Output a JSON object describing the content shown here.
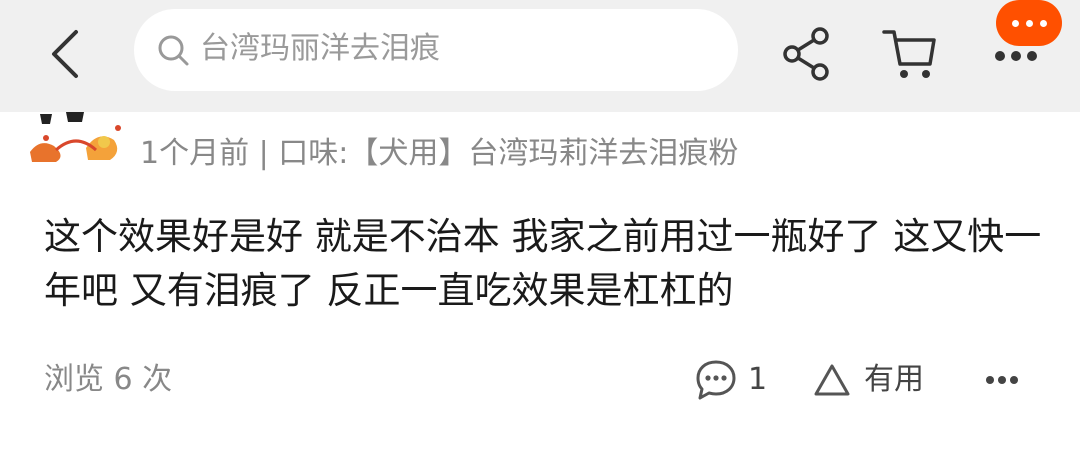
{
  "header": {
    "search_query": "台湾玛丽洋去泪痕"
  },
  "review": {
    "meta": "1个月前 | 口味:【犬用】台湾玛莉洋去泪痕粉",
    "text": "这个效果好是好 就是不治本 我家之前用过一瓶好了 这又快一年吧 又有泪痕了 反正一直吃效果是杠杠的",
    "views": "浏览 6 次",
    "comment_count": "1",
    "useful_label": "有用"
  },
  "colors": {
    "accent": "#ff5000",
    "header_bg": "#f0f0f0",
    "muted_text": "#888888"
  }
}
